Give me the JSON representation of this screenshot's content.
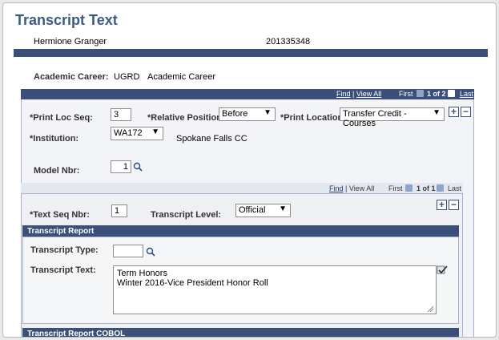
{
  "page": {
    "title": "Transcript Text",
    "student_name": "Hermione Granger",
    "student_id": "201335348"
  },
  "academic": {
    "career_label": "Academic Career:",
    "career_code": "UGRD",
    "career_desc": "Academic Career"
  },
  "grid1": {
    "find": "Find",
    "sep": "|",
    "view_all": "View All",
    "first": "First",
    "range": "1 of 2",
    "last": "Last"
  },
  "form1": {
    "print_loc_seq_label": "*Print Loc Seq:",
    "print_loc_seq_value": "3",
    "relative_position_label": "*Relative Position:",
    "relative_position_value": "Before",
    "print_location_label": "*Print Location:",
    "print_location_value": "Transfer Credit - Courses",
    "institution_label": "*Institution:",
    "institution_value": "WA172",
    "institution_name": "Spokane Falls CC",
    "model_nbr_label": "Model Nbr:",
    "model_nbr_value": "1"
  },
  "grid2": {
    "find": "Find",
    "sep": "|",
    "view_all": "View All",
    "first": "First",
    "range": "1 of 1",
    "last": "Last"
  },
  "form2": {
    "text_seq_label": "*Text Seq Nbr:",
    "text_seq_value": "1",
    "transcript_level_label": "Transcript Level:",
    "transcript_level_value": "Official"
  },
  "report": {
    "section_title": "Transcript Report",
    "type_label": "Transcript Type:",
    "type_value": "",
    "text_label": "Transcript Text:",
    "text_value": "Term Honors\nWinter 2016-Vice President Honor Roll",
    "cobol_title": "Transcript Report COBOL"
  },
  "icons": {
    "add": "+",
    "remove": "−",
    "dropdown": "▼"
  }
}
